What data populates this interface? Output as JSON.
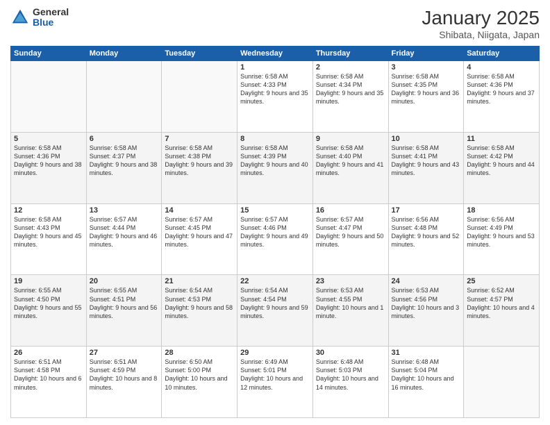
{
  "logo": {
    "general": "General",
    "blue": "Blue"
  },
  "header": {
    "month": "January 2025",
    "location": "Shibata, Niigata, Japan"
  },
  "weekdays": [
    "Sunday",
    "Monday",
    "Tuesday",
    "Wednesday",
    "Thursday",
    "Friday",
    "Saturday"
  ],
  "weeks": [
    [
      {
        "day": "",
        "info": ""
      },
      {
        "day": "",
        "info": ""
      },
      {
        "day": "",
        "info": ""
      },
      {
        "day": "1",
        "info": "Sunrise: 6:58 AM\nSunset: 4:33 PM\nDaylight: 9 hours and 35 minutes."
      },
      {
        "day": "2",
        "info": "Sunrise: 6:58 AM\nSunset: 4:34 PM\nDaylight: 9 hours and 35 minutes."
      },
      {
        "day": "3",
        "info": "Sunrise: 6:58 AM\nSunset: 4:35 PM\nDaylight: 9 hours and 36 minutes."
      },
      {
        "day": "4",
        "info": "Sunrise: 6:58 AM\nSunset: 4:36 PM\nDaylight: 9 hours and 37 minutes."
      }
    ],
    [
      {
        "day": "5",
        "info": "Sunrise: 6:58 AM\nSunset: 4:36 PM\nDaylight: 9 hours and 38 minutes."
      },
      {
        "day": "6",
        "info": "Sunrise: 6:58 AM\nSunset: 4:37 PM\nDaylight: 9 hours and 38 minutes."
      },
      {
        "day": "7",
        "info": "Sunrise: 6:58 AM\nSunset: 4:38 PM\nDaylight: 9 hours and 39 minutes."
      },
      {
        "day": "8",
        "info": "Sunrise: 6:58 AM\nSunset: 4:39 PM\nDaylight: 9 hours and 40 minutes."
      },
      {
        "day": "9",
        "info": "Sunrise: 6:58 AM\nSunset: 4:40 PM\nDaylight: 9 hours and 41 minutes."
      },
      {
        "day": "10",
        "info": "Sunrise: 6:58 AM\nSunset: 4:41 PM\nDaylight: 9 hours and 43 minutes."
      },
      {
        "day": "11",
        "info": "Sunrise: 6:58 AM\nSunset: 4:42 PM\nDaylight: 9 hours and 44 minutes."
      }
    ],
    [
      {
        "day": "12",
        "info": "Sunrise: 6:58 AM\nSunset: 4:43 PM\nDaylight: 9 hours and 45 minutes."
      },
      {
        "day": "13",
        "info": "Sunrise: 6:57 AM\nSunset: 4:44 PM\nDaylight: 9 hours and 46 minutes."
      },
      {
        "day": "14",
        "info": "Sunrise: 6:57 AM\nSunset: 4:45 PM\nDaylight: 9 hours and 47 minutes."
      },
      {
        "day": "15",
        "info": "Sunrise: 6:57 AM\nSunset: 4:46 PM\nDaylight: 9 hours and 49 minutes."
      },
      {
        "day": "16",
        "info": "Sunrise: 6:57 AM\nSunset: 4:47 PM\nDaylight: 9 hours and 50 minutes."
      },
      {
        "day": "17",
        "info": "Sunrise: 6:56 AM\nSunset: 4:48 PM\nDaylight: 9 hours and 52 minutes."
      },
      {
        "day": "18",
        "info": "Sunrise: 6:56 AM\nSunset: 4:49 PM\nDaylight: 9 hours and 53 minutes."
      }
    ],
    [
      {
        "day": "19",
        "info": "Sunrise: 6:55 AM\nSunset: 4:50 PM\nDaylight: 9 hours and 55 minutes."
      },
      {
        "day": "20",
        "info": "Sunrise: 6:55 AM\nSunset: 4:51 PM\nDaylight: 9 hours and 56 minutes."
      },
      {
        "day": "21",
        "info": "Sunrise: 6:54 AM\nSunset: 4:53 PM\nDaylight: 9 hours and 58 minutes."
      },
      {
        "day": "22",
        "info": "Sunrise: 6:54 AM\nSunset: 4:54 PM\nDaylight: 9 hours and 59 minutes."
      },
      {
        "day": "23",
        "info": "Sunrise: 6:53 AM\nSunset: 4:55 PM\nDaylight: 10 hours and 1 minute."
      },
      {
        "day": "24",
        "info": "Sunrise: 6:53 AM\nSunset: 4:56 PM\nDaylight: 10 hours and 3 minutes."
      },
      {
        "day": "25",
        "info": "Sunrise: 6:52 AM\nSunset: 4:57 PM\nDaylight: 10 hours and 4 minutes."
      }
    ],
    [
      {
        "day": "26",
        "info": "Sunrise: 6:51 AM\nSunset: 4:58 PM\nDaylight: 10 hours and 6 minutes."
      },
      {
        "day": "27",
        "info": "Sunrise: 6:51 AM\nSunset: 4:59 PM\nDaylight: 10 hours and 8 minutes."
      },
      {
        "day": "28",
        "info": "Sunrise: 6:50 AM\nSunset: 5:00 PM\nDaylight: 10 hours and 10 minutes."
      },
      {
        "day": "29",
        "info": "Sunrise: 6:49 AM\nSunset: 5:01 PM\nDaylight: 10 hours and 12 minutes."
      },
      {
        "day": "30",
        "info": "Sunrise: 6:48 AM\nSunset: 5:03 PM\nDaylight: 10 hours and 14 minutes."
      },
      {
        "day": "31",
        "info": "Sunrise: 6:48 AM\nSunset: 5:04 PM\nDaylight: 10 hours and 16 minutes."
      },
      {
        "day": "",
        "info": ""
      }
    ]
  ]
}
